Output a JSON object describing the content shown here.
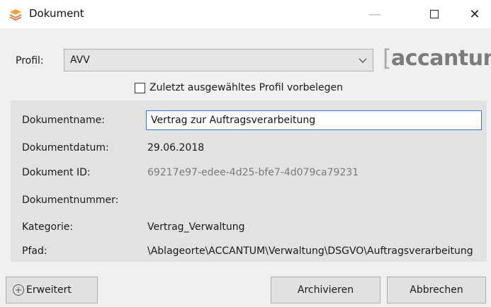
{
  "window": {
    "title": "Dokument",
    "minimize_glyph": "—",
    "close_glyph": "✕",
    "icon": "stacked-documents-icon"
  },
  "profile": {
    "label": "Profil:",
    "selected": "AVV",
    "checkbox_label": "Zuletzt ausgewähltes Profil vorbelegen",
    "checkbox_checked": false
  },
  "logo": {
    "bracket_open": "[",
    "text": "accantum",
    "bracket_close": "]"
  },
  "fields": {
    "dokumentname_label": "Dokumentname:",
    "dokumentname_value": "Vertrag zur Auftragsverarbeitung",
    "dokumentdatum_label": "Dokumentdatum:",
    "dokumentdatum_value": "29.06.2018",
    "dokument_id_label": "Dokument ID:",
    "dokument_id_value": "69217e97-edee-4d25-bfe7-4d079ca79231",
    "dokumentnummer_label": "Dokumentnummer:",
    "kategorie_label": "Kategorie:",
    "kategorie_value": "Vertrag_Verwaltung",
    "pfad_label": "Pfad:",
    "pfad_value": "\\Ablageorte\\ACCANTUM\\Verwaltung\\DSGVO\\Auftragsverarbeitung"
  },
  "buttons": {
    "erweitert": "Erweitert",
    "archivieren": "Archivieren",
    "abbrechen": "Abbrechen"
  },
  "colors": {
    "icon_orange": "#e8731c",
    "focus_border": "#2f7ccb",
    "panel_bg": "#e2e2e2"
  }
}
